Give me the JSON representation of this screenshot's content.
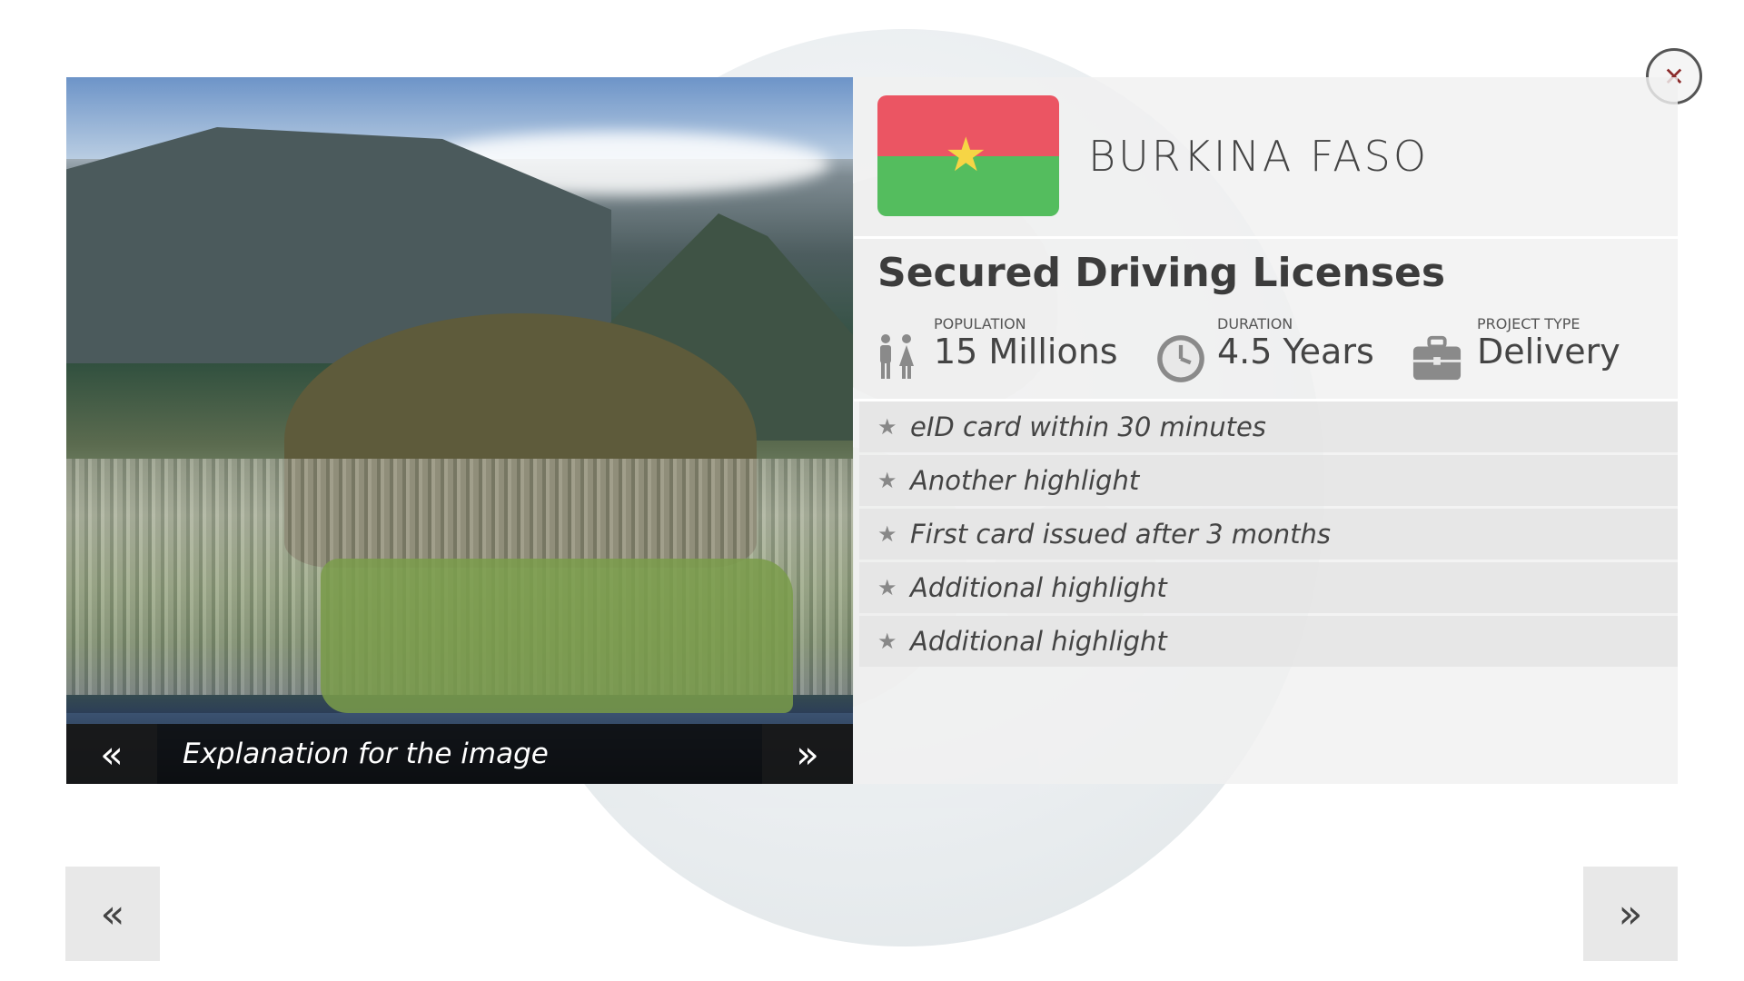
{
  "country": {
    "name": "BURKINA FASO"
  },
  "flag": {
    "top_color": "#eb5563",
    "bottom_color": "#54bd5e",
    "star_color": "#f6d545",
    "star_glyph": "★"
  },
  "project": {
    "title": "Secured Driving Licenses"
  },
  "stats": {
    "population": {
      "label": "POPULATION",
      "value": "15 Millions",
      "icon": "people-icon"
    },
    "duration": {
      "label": "DURATION",
      "value": "4.5 Years",
      "icon": "clock-icon"
    },
    "project_type": {
      "label": "PROJECT TYPE",
      "value": "Delivery",
      "icon": "briefcase-icon"
    }
  },
  "highlights": [
    {
      "text": "eID card within 30 minutes"
    },
    {
      "text": "Another highlight"
    },
    {
      "text": "First card issued after 3 months"
    },
    {
      "text": "Additional highlight"
    },
    {
      "text": "Additional highlight"
    }
  ],
  "gallery": {
    "caption": "Explanation for the image",
    "prev_glyph": "«",
    "next_glyph": "»"
  },
  "navigation": {
    "prev_glyph": "«",
    "next_glyph": "»"
  },
  "close": {
    "glyph": "✕"
  }
}
